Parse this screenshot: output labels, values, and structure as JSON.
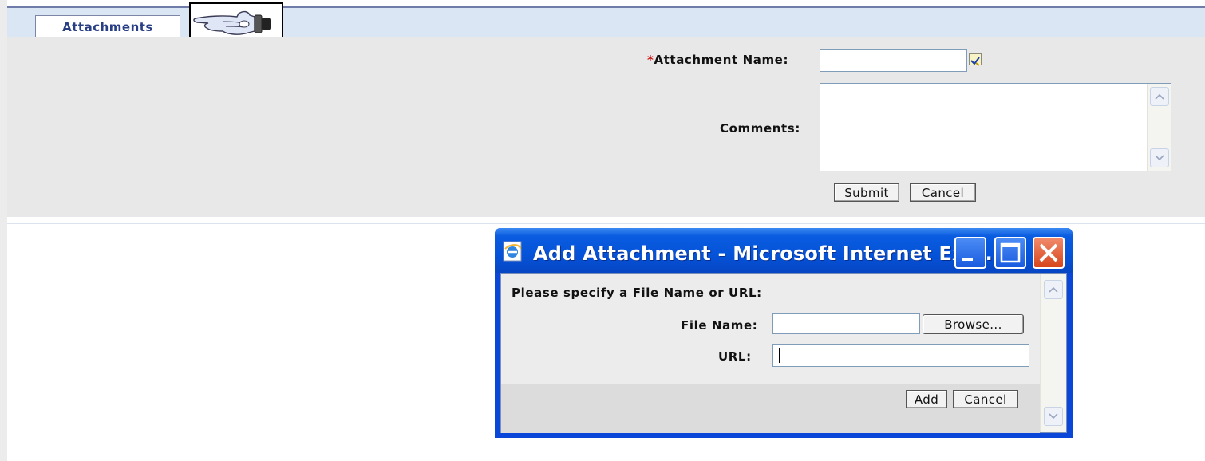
{
  "tab": {
    "label": "Attachments"
  },
  "hint_icon": "pointing-hand-lightbulb-icon",
  "form": {
    "attachment_name_required_marker": "*",
    "attachment_name_label": "Attachment Name:",
    "attachment_name_value": "",
    "spell_check_icon": "spell-check-icon",
    "comments_label": "Comments:",
    "comments_value": "",
    "submit_label": "Submit",
    "cancel_label": "Cancel"
  },
  "dialog": {
    "title": "Add Attachment - Microsoft Internet Expl...",
    "icon": "internet-explorer-icon",
    "prompt": "Please specify a File Name or URL:",
    "file_name_label": "File Name:",
    "file_name_value": "",
    "browse_label": "Browse...",
    "url_label": "URL:",
    "url_value": "",
    "add_label": "Add",
    "cancel_label": "Cancel"
  },
  "colors": {
    "tab_text": "#283f85",
    "tab_strip": "#dbe6f5",
    "panel": "#e8e8e8",
    "required": "#cc1111",
    "xp_title": "#0553d8",
    "xp_close": "#d7451b"
  }
}
